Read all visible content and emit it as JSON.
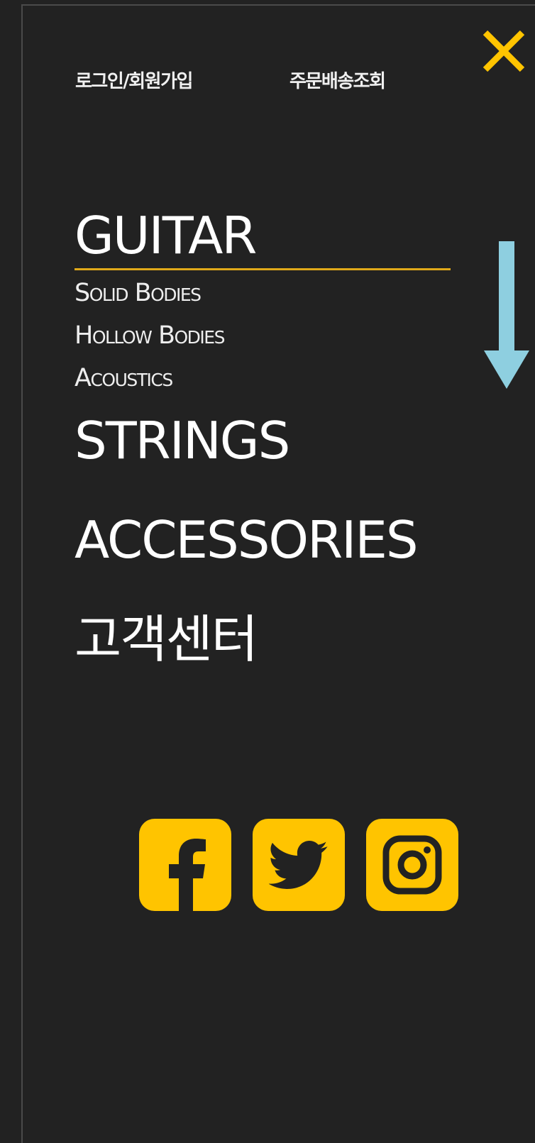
{
  "colors": {
    "background": "#222222",
    "accent": "#ffc400",
    "underline": "#e0a91a",
    "arrow": "#8ecfe0",
    "text": "#ffffff"
  },
  "top_nav": {
    "login_label": "로그인/회원가입",
    "order_tracking_label": "주문배송조회",
    "close_icon": "close-icon"
  },
  "menu": {
    "guitar": {
      "label": "GUITAR",
      "items": [
        "Solid Bodies",
        "Hollow Bodies",
        "Acoustics"
      ]
    },
    "strings": {
      "label": "STRINGS"
    },
    "accessories": {
      "label": "ACCESSORIES"
    },
    "support": {
      "label": "고객센터"
    }
  },
  "social": [
    {
      "icon": "facebook-icon"
    },
    {
      "icon": "twitter-icon"
    },
    {
      "icon": "instagram-icon"
    }
  ]
}
